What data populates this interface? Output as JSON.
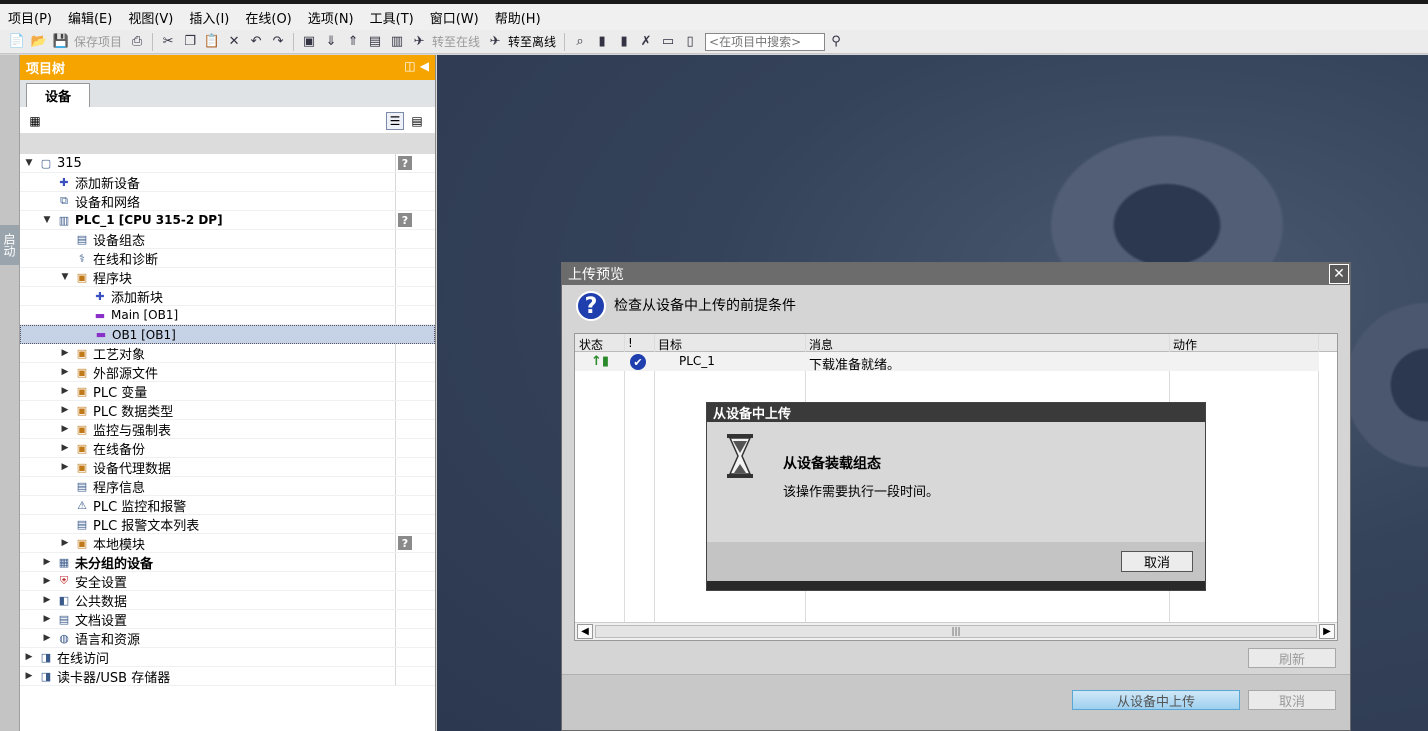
{
  "menu": [
    "项目(P)",
    "编辑(E)",
    "视图(V)",
    "插入(I)",
    "在线(O)",
    "选项(N)",
    "工具(T)",
    "窗口(W)",
    "帮助(H)"
  ],
  "toolbar": {
    "save_project": "保存项目",
    "go_online": "转至在线",
    "go_offline": "转至离线",
    "search_placeholder": "<在项目中搜索>"
  },
  "side_tab": "启动",
  "project_tree": {
    "title": "项目树",
    "tab": "设备",
    "rows": [
      {
        "label": "315",
        "level": 0,
        "toggle": "open",
        "icon": "project-icon",
        "help": true
      },
      {
        "label": "添加新设备",
        "level": 1,
        "toggle": "none",
        "icon": "add-device-icon"
      },
      {
        "label": "设备和网络",
        "level": 1,
        "toggle": "none",
        "icon": "network-icon"
      },
      {
        "label": "PLC_1 [CPU 315-2 DP]",
        "level": 1,
        "toggle": "open",
        "icon": "plc-icon",
        "help": true,
        "bold": true,
        "small": true
      },
      {
        "label": "设备组态",
        "level": 2,
        "toggle": "none",
        "icon": "device-config-icon"
      },
      {
        "label": "在线和诊断",
        "level": 2,
        "toggle": "none",
        "icon": "diagnostics-icon"
      },
      {
        "label": "程序块",
        "level": 2,
        "toggle": "open",
        "icon": "folder-icon"
      },
      {
        "label": "添加新块",
        "level": 3,
        "toggle": "none",
        "icon": "add-block-icon"
      },
      {
        "label": "Main [OB1]",
        "level": 3,
        "toggle": "none",
        "icon": "ob-block-icon",
        "small": true
      },
      {
        "label": "OB1 [OB1]",
        "level": 3,
        "toggle": "none",
        "icon": "ob-block-icon",
        "small": true,
        "selected": true
      },
      {
        "label": "工艺对象",
        "level": 2,
        "toggle": "closed",
        "icon": "folder-icon"
      },
      {
        "label": "外部源文件",
        "level": 2,
        "toggle": "closed",
        "icon": "folder-icon"
      },
      {
        "label": "PLC 变量",
        "level": 2,
        "toggle": "closed",
        "icon": "folder-icon"
      },
      {
        "label": "PLC 数据类型",
        "level": 2,
        "toggle": "closed",
        "icon": "folder-icon"
      },
      {
        "label": "监控与强制表",
        "level": 2,
        "toggle": "closed",
        "icon": "folder-icon"
      },
      {
        "label": "在线备份",
        "level": 2,
        "toggle": "closed",
        "icon": "folder-icon"
      },
      {
        "label": "设备代理数据",
        "level": 2,
        "toggle": "closed",
        "icon": "folder-icon"
      },
      {
        "label": "程序信息",
        "level": 2,
        "toggle": "none",
        "icon": "program-info-icon"
      },
      {
        "label": "PLC 监控和报警",
        "level": 2,
        "toggle": "none",
        "icon": "alarm-icon"
      },
      {
        "label": "PLC 报警文本列表",
        "level": 2,
        "toggle": "none",
        "icon": "text-list-icon"
      },
      {
        "label": "本地模块",
        "level": 2,
        "toggle": "closed",
        "icon": "folder-icon",
        "help": true
      },
      {
        "label": "未分组的设备",
        "level": 1,
        "toggle": "closed",
        "icon": "ungrouped-devices-icon",
        "bold": true
      },
      {
        "label": "安全设置",
        "level": 1,
        "toggle": "closed",
        "icon": "security-icon"
      },
      {
        "label": "公共数据",
        "level": 1,
        "toggle": "closed",
        "icon": "common-data-icon"
      },
      {
        "label": "文档设置",
        "level": 1,
        "toggle": "closed",
        "icon": "document-icon"
      },
      {
        "label": "语言和资源",
        "level": 1,
        "toggle": "closed",
        "icon": "language-icon"
      },
      {
        "label": "在线访问",
        "level": 0,
        "toggle": "closed",
        "icon": "online-access-icon"
      },
      {
        "label": "读卡器/USB 存储器",
        "level": 0,
        "toggle": "closed",
        "icon": "card-reader-icon"
      }
    ]
  },
  "upload_preview": {
    "title": "上传预览",
    "heading": "检查从设备中上传的前提条件",
    "columns": {
      "status": "状态",
      "bang": "!",
      "target": "目标",
      "message": "消息",
      "action": "动作"
    },
    "row": {
      "target": "PLC_1",
      "message": "下载准备就绪。"
    },
    "refresh_button": "刷新",
    "upload_button": "从设备中上传",
    "cancel_button": "取消"
  },
  "upload_dialog": {
    "title": "从设备中上传",
    "heading": "从设备装载组态",
    "subtext": "该操作需要执行一段时间。",
    "cancel_button": "取消"
  }
}
